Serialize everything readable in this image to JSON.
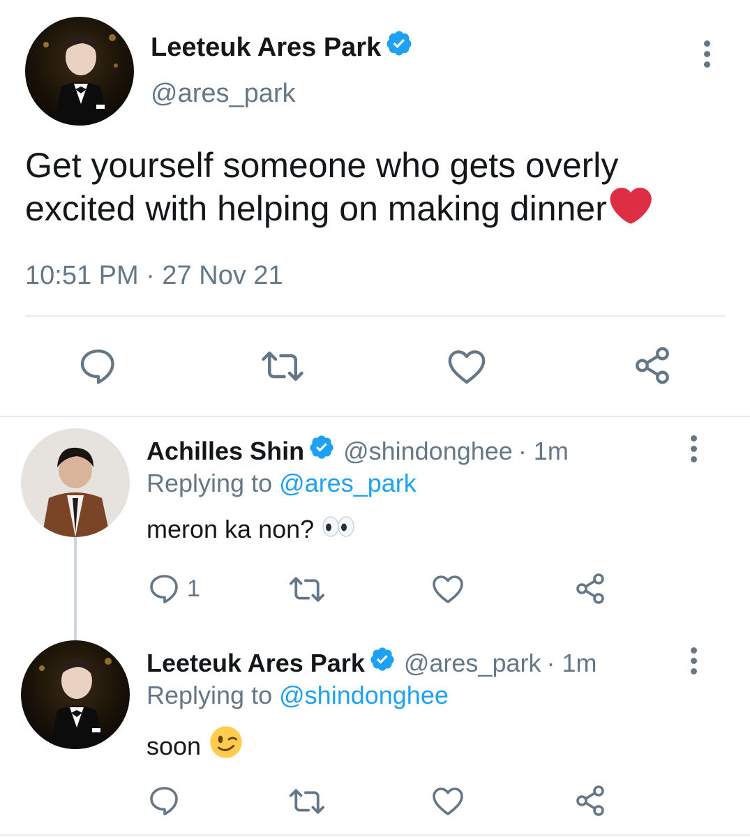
{
  "main_tweet": {
    "author_name": "Leeteuk Ares Park",
    "handle": "@ares_park",
    "text": "Get yourself someone who gets overly excited with helping on making dinner",
    "emoji": "red-heart",
    "timestamp": "10:51 PM · 27 Nov 21",
    "verified": true
  },
  "replies": [
    {
      "author_name": "Achilles Shin",
      "handle": "@shindonghee",
      "time": "· 1m",
      "replying_prefix": "Replying to",
      "replying_to": "@ares_park",
      "text": "meron ka non?",
      "emoji": "eyes",
      "reply_count": "1",
      "verified": true
    },
    {
      "author_name": "Leeteuk Ares Park",
      "handle": "@ares_park",
      "time": "· 1m",
      "replying_prefix": "Replying to",
      "replying_to": "@shindonghee",
      "text": "soon",
      "emoji": "winking-face",
      "reply_count": "",
      "verified": true
    }
  ],
  "colors": {
    "accent": "#1da1f2",
    "secondary_text": "#657786",
    "divider": "#e6ecf0",
    "heart": "#e0245e"
  },
  "icons": [
    "reply-icon",
    "retweet-icon",
    "like-icon",
    "share-icon",
    "more-icon",
    "verified-badge-icon"
  ]
}
